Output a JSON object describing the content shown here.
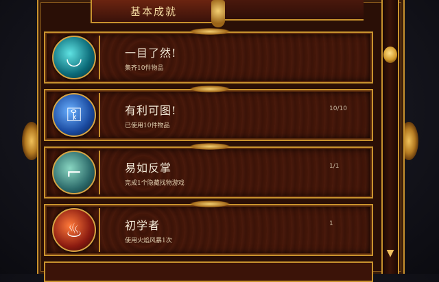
{
  "header": {
    "title": "基本成就"
  },
  "achievements": [
    {
      "title": "一目了然!",
      "desc": "集齐10件物品",
      "progress": "",
      "icon": "teal-bowl-icon"
    },
    {
      "title": "有利可图!",
      "desc": "已使用10件物品",
      "progress": "10/10",
      "icon": "key-icon"
    },
    {
      "title": "易如反掌",
      "desc": "完成1个隐藏找物游戏",
      "progress": "1/1",
      "icon": "pipe-icon"
    },
    {
      "title": "初学者",
      "desc": "使用火焰风暴1次",
      "progress": "1",
      "icon": "fire-figure-icon"
    }
  ],
  "colors": {
    "gold": "#c9932e",
    "panel": "#3b1308",
    "text": "#f3ead8"
  }
}
